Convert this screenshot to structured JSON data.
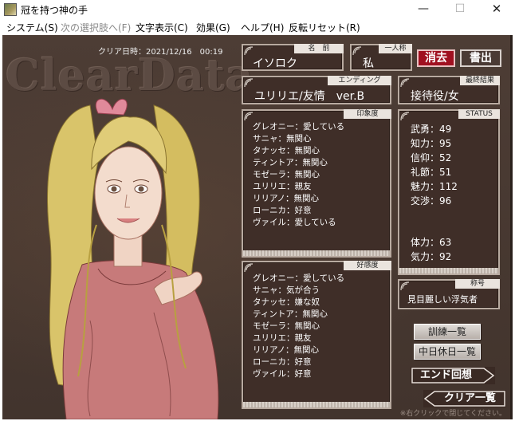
{
  "window": {
    "title": "冠を持つ神の手",
    "minimize": "—",
    "maximize": "☐",
    "close": "✕"
  },
  "menu": {
    "items": [
      {
        "label": "システム(S)"
      },
      {
        "label": "次の選択肢へ(F)",
        "disabled": true
      },
      {
        "label": "文字表示(C)"
      },
      {
        "label": "効果(G)"
      },
      {
        "label": "ヘルプ(H)"
      },
      {
        "label": "反転リセット(R)"
      }
    ]
  },
  "screen": {
    "logo": "ClearData",
    "clear_date": "クリア日時：2021/12/16　00:19",
    "name": {
      "label": "名　前",
      "value": "イソロク"
    },
    "pronoun": {
      "label": "一人称",
      "value": "私"
    },
    "ending": {
      "label": "エンディング",
      "value": "ユリリエ/友情　ver.B"
    },
    "final_result": {
      "label": "最終結果",
      "value": "接待役/女"
    },
    "impression": {
      "label": "印象度",
      "entries": [
        "グレオニー：愛している",
        "サニャ：無関心",
        "タナッセ：無関心",
        "ティントア：無関心",
        "モゼーラ：無関心",
        "ユリリエ：親友",
        "リリアノ：無関心",
        "ローニカ：好意",
        "ヴァイル：愛している"
      ]
    },
    "favor": {
      "label": "好感度",
      "entries": [
        "グレオニー：愛している",
        "サニャ：気が合う",
        "タナッセ：嫌な奴",
        "ティントア：無関心",
        "モゼーラ：無関心",
        "ユリリエ：親友",
        "リリアノ：無関心",
        "ローニカ：好意",
        "ヴァイル：好意"
      ]
    },
    "status": {
      "label": "STATUS",
      "stats": [
        "武勇：49",
        "知力：95",
        "信仰：52",
        "礼節：51",
        "魅力：112",
        "交渉：96"
      ],
      "stats2": [
        "体力：63",
        "気力：92"
      ]
    },
    "title_box": {
      "label": "称号",
      "value": "見目麗しい浮気者"
    },
    "buttons": {
      "erase": "消去",
      "save": "書出",
      "training": "訓練一覧",
      "holiday": "中日休日一覧",
      "end_recall": "エンド回想",
      "clear_list": "クリア一覧"
    },
    "hint": "※右クリックで閉じてください。",
    "colors": {
      "background": "#4a3a32",
      "erase_button": "#a01020"
    }
  }
}
